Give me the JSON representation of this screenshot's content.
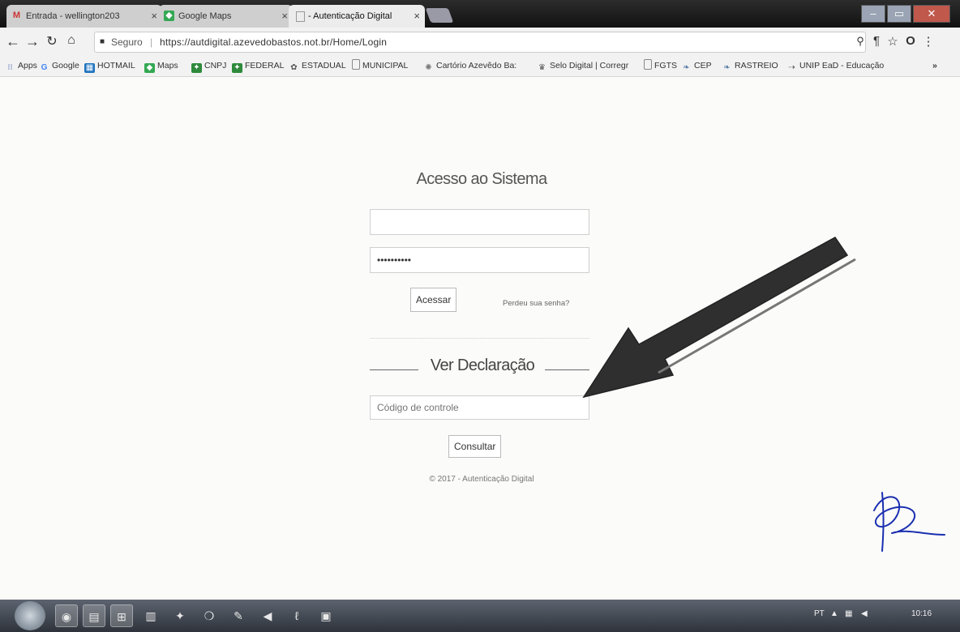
{
  "browser": {
    "tabs": [
      {
        "title": "Entrada - wellington203",
        "icon": "gmail-icon"
      },
      {
        "title": "Google Maps",
        "icon": "maps-icon"
      },
      {
        "title": "- Autenticação Digital",
        "icon": "page-icon"
      }
    ],
    "security_label": "Seguro",
    "url": "https://autdigital.azevedobastos.not.br/Home/Login",
    "bookmarks": [
      {
        "label": "Apps",
        "icon": "apps-grid-icon",
        "color": "#3b5aa5"
      },
      {
        "label": "Google",
        "icon": "google-icon",
        "color": "#4285f4"
      },
      {
        "label": "HOTMAIL",
        "icon": "hotmail-icon",
        "color": "#1e73be"
      },
      {
        "label": "Maps",
        "icon": "maps-icon",
        "color": "#34a853"
      },
      {
        "label": "CNPJ",
        "icon": "cnpj-icon",
        "color": "#2f8a3c"
      },
      {
        "label": "FEDERAL",
        "icon": "federal-icon",
        "color": "#2f8a3c"
      },
      {
        "label": "ESTADUAL",
        "icon": "estadual-icon",
        "color": "#555555"
      },
      {
        "label": "MUNICIPAL",
        "icon": "page-icon",
        "color": "#888888"
      },
      {
        "label": "Cartório Azevêdo Ba:",
        "icon": "cartorio-icon",
        "color": "#777777"
      },
      {
        "label": "Selo Digital | Corregr",
        "icon": "selo-icon",
        "color": "#555555"
      },
      {
        "label": "FGTS",
        "icon": "page-icon",
        "color": "#888888"
      },
      {
        "label": "CEP",
        "icon": "cep-icon",
        "color": "#5a7da8"
      },
      {
        "label": "RASTREIO",
        "icon": "rastreio-icon",
        "color": "#5a7da8"
      },
      {
        "label": "UNIP EaD - Educação",
        "icon": "unip-icon",
        "color": "#555555"
      }
    ],
    "more_bookmarks": "»"
  },
  "login": {
    "title": "Acesso ao Sistema",
    "username_value": "",
    "password_value": "••••••••••",
    "submit_label": "Acessar",
    "forgot_label": "Perdeu sua senha?"
  },
  "declaration": {
    "title": "Ver Declaração",
    "code_placeholder": "Código de controle",
    "submit_label": "Consultar"
  },
  "footer": "© 2017 - Autenticação Digital",
  "taskbar": {
    "tray_lang": "PT",
    "clock": "10:16"
  },
  "colors": {
    "annotation_arrow": "#2f2f2f",
    "signature_ink": "#1a2fb0"
  }
}
